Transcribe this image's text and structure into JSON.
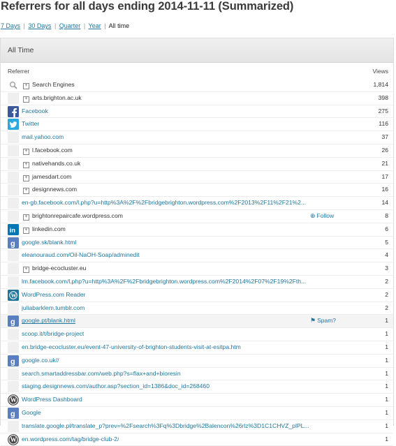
{
  "header": {
    "title": "Referrers for all days ending 2014-11-11 (Summarized)"
  },
  "range_nav": {
    "items": [
      "7 Days",
      "30 Days",
      "Quarter",
      "Year"
    ],
    "separator": "|",
    "current": "All time"
  },
  "panel": {
    "title": "All Time",
    "col_referrer": "Referrer",
    "col_views": "Views"
  },
  "rows": [
    {
      "icon": "search-icon",
      "label": "Search Engines",
      "expand": true,
      "style": "plain",
      "views": "1,814"
    },
    {
      "icon": "blank",
      "label": "arts.brighton.ac.uk",
      "expand": true,
      "style": "plain",
      "views": "398"
    },
    {
      "icon": "facebook-icon",
      "label": "Facebook",
      "expand": false,
      "style": "link",
      "views": "275"
    },
    {
      "icon": "twitter-icon",
      "label": "Twitter",
      "expand": false,
      "style": "link",
      "views": "116"
    },
    {
      "icon": "blank",
      "label": "mail.yahoo.com",
      "expand": false,
      "style": "link",
      "views": "37"
    },
    {
      "icon": "blank",
      "label": "l.facebook.com",
      "expand": true,
      "style": "plain",
      "views": "26"
    },
    {
      "icon": "blank",
      "label": "nativehands.co.uk",
      "expand": true,
      "style": "plain",
      "views": "21"
    },
    {
      "icon": "blank",
      "label": "jamesdart.com",
      "expand": true,
      "style": "plain",
      "views": "17"
    },
    {
      "icon": "blank",
      "label": "designnews.com",
      "expand": true,
      "style": "plain",
      "views": "16"
    },
    {
      "icon": "blank",
      "label": "en-gb.facebook.com/l.php?u=http%3A%2F%2Fbridgebrighton.wordpress.com%2F2013%2F11%2F21%2...",
      "expand": false,
      "style": "link",
      "views": "14"
    },
    {
      "icon": "blank",
      "label": "brightonrepaircafe.wordpress.com",
      "expand": true,
      "style": "plain",
      "views": "8",
      "action": "Follow"
    },
    {
      "icon": "linkedin-icon",
      "label": "linkedin.com",
      "expand": true,
      "style": "plain",
      "views": "6"
    },
    {
      "icon": "google-icon",
      "label": "google.sk/blank.html",
      "expand": false,
      "style": "link",
      "views": "5"
    },
    {
      "icon": "blank",
      "label": "eleanouraud.com/Oil-NaOH-Soap/adminedit",
      "expand": false,
      "style": "link",
      "views": "4"
    },
    {
      "icon": "blank",
      "label": "bridge-ecocluster.eu",
      "expand": true,
      "style": "plain",
      "views": "3"
    },
    {
      "icon": "blank",
      "label": "lm.facebook.com/l.php?u=http%3A%2F%2Fbridgebrighton.wordpress.com%2F2014%2F07%2F19%2Fth...",
      "expand": false,
      "style": "link",
      "views": "2"
    },
    {
      "icon": "wordpress-reader-icon",
      "label": "WordPress.com Reader",
      "expand": false,
      "style": "link",
      "views": "2"
    },
    {
      "icon": "blank",
      "label": "juliabarklem.tumblr.com",
      "expand": false,
      "style": "link",
      "views": "2"
    },
    {
      "icon": "google-icon",
      "label": "google.pt/blank.html",
      "expand": false,
      "style": "link-u",
      "views": "1",
      "action": "Spam?",
      "highlight": true
    },
    {
      "icon": "blank",
      "label": "scoop.it/t/bridge-project",
      "expand": false,
      "style": "link",
      "views": "1"
    },
    {
      "icon": "blank",
      "label": "en.bridge-ecocluster.eu/event-47-university-of-brighton-students-visit-at-esitpa.htm",
      "expand": false,
      "style": "link",
      "views": "1"
    },
    {
      "icon": "google-icon",
      "label": "google.co.uk//",
      "expand": false,
      "style": "link",
      "views": "1"
    },
    {
      "icon": "blank",
      "label": "search.smartaddressbar.com/web.php?s=flax+and+bioresin",
      "expand": false,
      "style": "link",
      "views": "1"
    },
    {
      "icon": "blank",
      "label": "staging.designnews.com/author.asp?section_id=1386&doc_id=268460",
      "expand": false,
      "style": "link",
      "views": "1"
    },
    {
      "icon": "wordpress-icon",
      "label": "WordPress Dashboard",
      "expand": false,
      "style": "link",
      "views": "1"
    },
    {
      "icon": "google-icon",
      "label": "Google",
      "expand": false,
      "style": "link",
      "views": "1"
    },
    {
      "icon": "blank",
      "label": "translate.google.pl/translate_p?prev=%2Fsearch%3Fq%3Dbridge%2Balencon%26rlz%3D1C1CHVZ_plPL...",
      "expand": false,
      "style": "link",
      "views": "1"
    },
    {
      "icon": "wordpress-icon",
      "label": "en.wordpress.com/tag/bridge-club-2/",
      "expand": false,
      "style": "link",
      "views": "1"
    }
  ],
  "colors": {
    "link": "#21759b",
    "facebook": "#3b5998",
    "twitter": "#2aa9e0",
    "linkedin": "#0077b5",
    "google": "#5a7fc0",
    "wordpress": "#21759b"
  }
}
